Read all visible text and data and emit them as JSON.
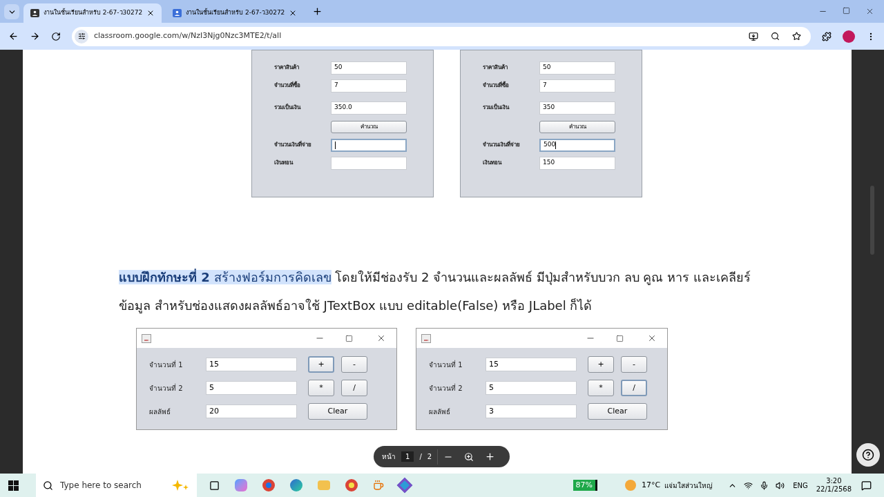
{
  "browser": {
    "tabs": [
      {
        "title": "งานในชั้นเรียนสำหรับ 2-67-ว30272",
        "selected": true
      },
      {
        "title": "งานในชั้นเรียนสำหรับ 2-67-ว30272",
        "selected": false
      }
    ],
    "url": "classroom.google.com/w/NzI3Njg0Nzc3MTE2/t/all"
  },
  "top_forms": [
    {
      "rows": [
        {
          "kind": "field",
          "label": "ราคาสินค้า",
          "value": "50",
          "focused": false
        },
        {
          "kind": "field",
          "label": "จำนวนที่ซื้อ",
          "value": "7",
          "focused": false
        },
        {
          "kind": "field",
          "label": "รวมเป็นเงิน",
          "value": "350.0",
          "focused": false
        },
        {
          "kind": "button",
          "label": "คำนวณ"
        },
        {
          "kind": "field",
          "label": "จำนวนเงินที่จ่าย",
          "focused": true
        },
        {
          "kind": "field",
          "label": "เงินทอน",
          "focused": false
        }
      ]
    },
    {
      "rows": [
        {
          "kind": "field",
          "label": "ราคาสินค้า",
          "value": "50",
          "focused": false
        },
        {
          "kind": "field",
          "label": "จำนวนที่ซื้อ",
          "value": "7",
          "focused": false
        },
        {
          "kind": "field",
          "label": "รวมเป็นเงิน",
          "value": "350",
          "focused": false
        },
        {
          "kind": "button",
          "label": "คำนวณ"
        },
        {
          "kind": "field",
          "label": "จำนวนเงินที่จ่าย",
          "value": "500",
          "focused": true
        },
        {
          "kind": "field",
          "label": "เงินทอน",
          "value": "150",
          "focused": false
        }
      ]
    }
  ],
  "exercise": {
    "highlighted": "**แบบฝึกทักษะที่ 2** สร้างฟอร์มการคิดเลข",
    "text": " โดยให้มีช่องรับ 2 จำนวนและผลลัพธ์  มีปุ่มสำหรับบวก ลบ คูณ หาร และเคลียร์ข้อมูล สำหรับช่องแสดงผลลัพธ์อาจใช้ JTextBox แบบ editable(False) หรือ JLabel ก็ได้"
  },
  "calc_windows": [
    {
      "rows": [
        {
          "label": "จำนวนที่ 1",
          "value": "15",
          "buttons": [
            {
              "label": "+",
              "focused": true
            },
            {
              "label": "-",
              "focused": false
            }
          ]
        },
        {
          "label": "จำนวนที่ 2",
          "value": "5",
          "buttons": [
            {
              "label": "*",
              "focused": false
            },
            {
              "label": "/",
              "focused": false
            }
          ]
        },
        {
          "label": "ผลลัพธ์",
          "value": "20",
          "buttons": [
            {
              "label": "Clear",
              "focused": false
            }
          ]
        }
      ]
    },
    {
      "rows": [
        {
          "label": "จำนวนที่ 1",
          "value": "15",
          "buttons": [
            {
              "label": "+",
              "focused": false
            },
            {
              "label": "-",
              "focused": false
            }
          ]
        },
        {
          "label": "จำนวนที่ 2",
          "value": "5",
          "buttons": [
            {
              "label": "*",
              "focused": false
            },
            {
              "label": "/",
              "focused": true
            }
          ]
        },
        {
          "label": "ผลลัพธ์",
          "value": "3",
          "buttons": [
            {
              "label": "Clear",
              "focused": false
            }
          ]
        }
      ]
    }
  ],
  "pdf_toolbar": {
    "page_label": "หน้า",
    "page": "1",
    "separator": "/",
    "total": "2"
  },
  "taskbar": {
    "search_placeholder": "Type here to search",
    "battery": "87%",
    "temperature": "17°C",
    "weather": "แจ่มใสส่วนใหญ่",
    "language": "ENG",
    "time": "3:20",
    "date": "22/1/2568"
  }
}
